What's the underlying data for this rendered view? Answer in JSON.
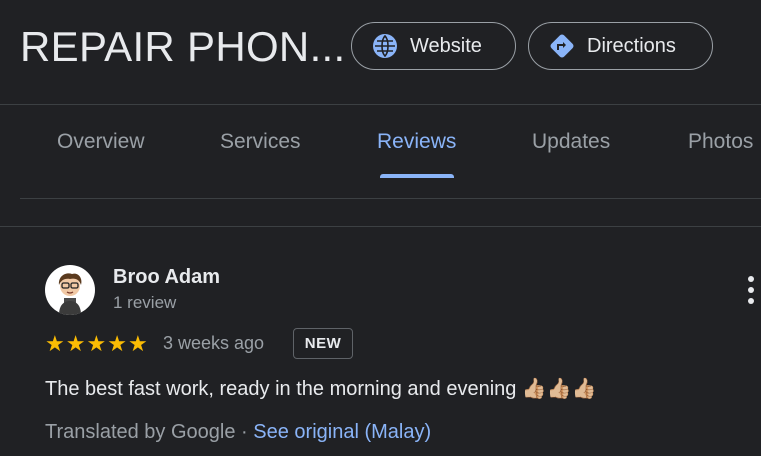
{
  "header": {
    "title": "REPAIR PHON...",
    "website_label": "Website",
    "directions_label": "Directions"
  },
  "tabs": [
    {
      "label": "Overview"
    },
    {
      "label": "Services"
    },
    {
      "label": "Reviews",
      "active": true
    },
    {
      "label": "Updates"
    },
    {
      "label": "Photos"
    }
  ],
  "review": {
    "author": "Broo Adam",
    "author_count": "1 review",
    "rating": 5,
    "rating_max": 5,
    "time": "3 weeks ago",
    "badge": "NEW",
    "text": "The best fast work, ready in the morning and evening 👍🏼👍🏼👍🏼",
    "translated_by": "Translated by Google",
    "separator": " · ",
    "see_original": "See original (Malay)"
  },
  "colors": {
    "background": "#202124",
    "accent": "#8ab4f8",
    "star": "#fbbc04",
    "muted": "#9aa0a6"
  },
  "icons": {
    "website": "globe-icon",
    "directions": "directions-icon",
    "more": "more-vert-icon"
  }
}
